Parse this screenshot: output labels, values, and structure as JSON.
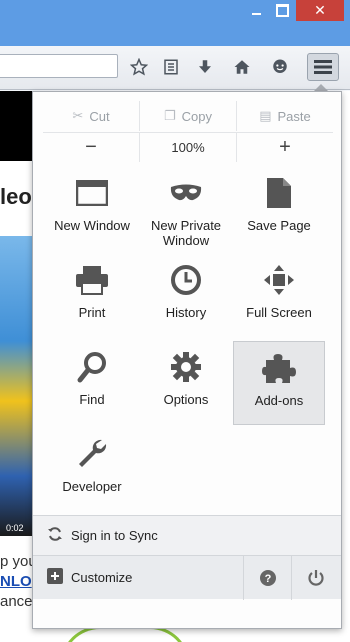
{
  "window": {
    "controls": [
      "minimize-icon",
      "maximize-icon",
      "close-icon"
    ],
    "close_color": "#c7413a",
    "titlebar_color": "#5d9ce4"
  },
  "toolbar": {
    "icons": [
      "star-icon",
      "reading-list-icon",
      "download-icon",
      "home-icon",
      "chat-icon",
      "hamburger-menu-icon"
    ]
  },
  "page": {
    "heading": "leo",
    "video_time": "0:02",
    "text_lines": [
      "p your",
      "NLO",
      "ance of your Internet."
    ]
  },
  "menu": {
    "edit": {
      "cut": "Cut",
      "copy": "Copy",
      "paste": "Paste"
    },
    "zoom": {
      "minus": "−",
      "level": "100%",
      "plus": "+"
    },
    "items": [
      {
        "id": "new-window",
        "label": "New Window",
        "icon": "window-icon"
      },
      {
        "id": "new-private-window",
        "label": "New Private Window",
        "icon": "mask-icon"
      },
      {
        "id": "save-page",
        "label": "Save Page",
        "icon": "page-icon"
      },
      {
        "id": "print",
        "label": "Print",
        "icon": "printer-icon"
      },
      {
        "id": "history",
        "label": "History",
        "icon": "clock-icon"
      },
      {
        "id": "full-screen",
        "label": "Full Screen",
        "icon": "fullscreen-icon"
      },
      {
        "id": "find",
        "label": "Find",
        "icon": "magnifier-icon"
      },
      {
        "id": "options",
        "label": "Options",
        "icon": "gear-icon"
      },
      {
        "id": "add-ons",
        "label": "Add-ons",
        "icon": "puzzle-icon"
      },
      {
        "id": "developer",
        "label": "Developer",
        "icon": "wrench-icon"
      }
    ],
    "sync_label": "Sign in to Sync",
    "customize_label": "Customize"
  },
  "colors": {
    "hover_bg": "#e6e7e9",
    "link": "#1a4db3"
  }
}
